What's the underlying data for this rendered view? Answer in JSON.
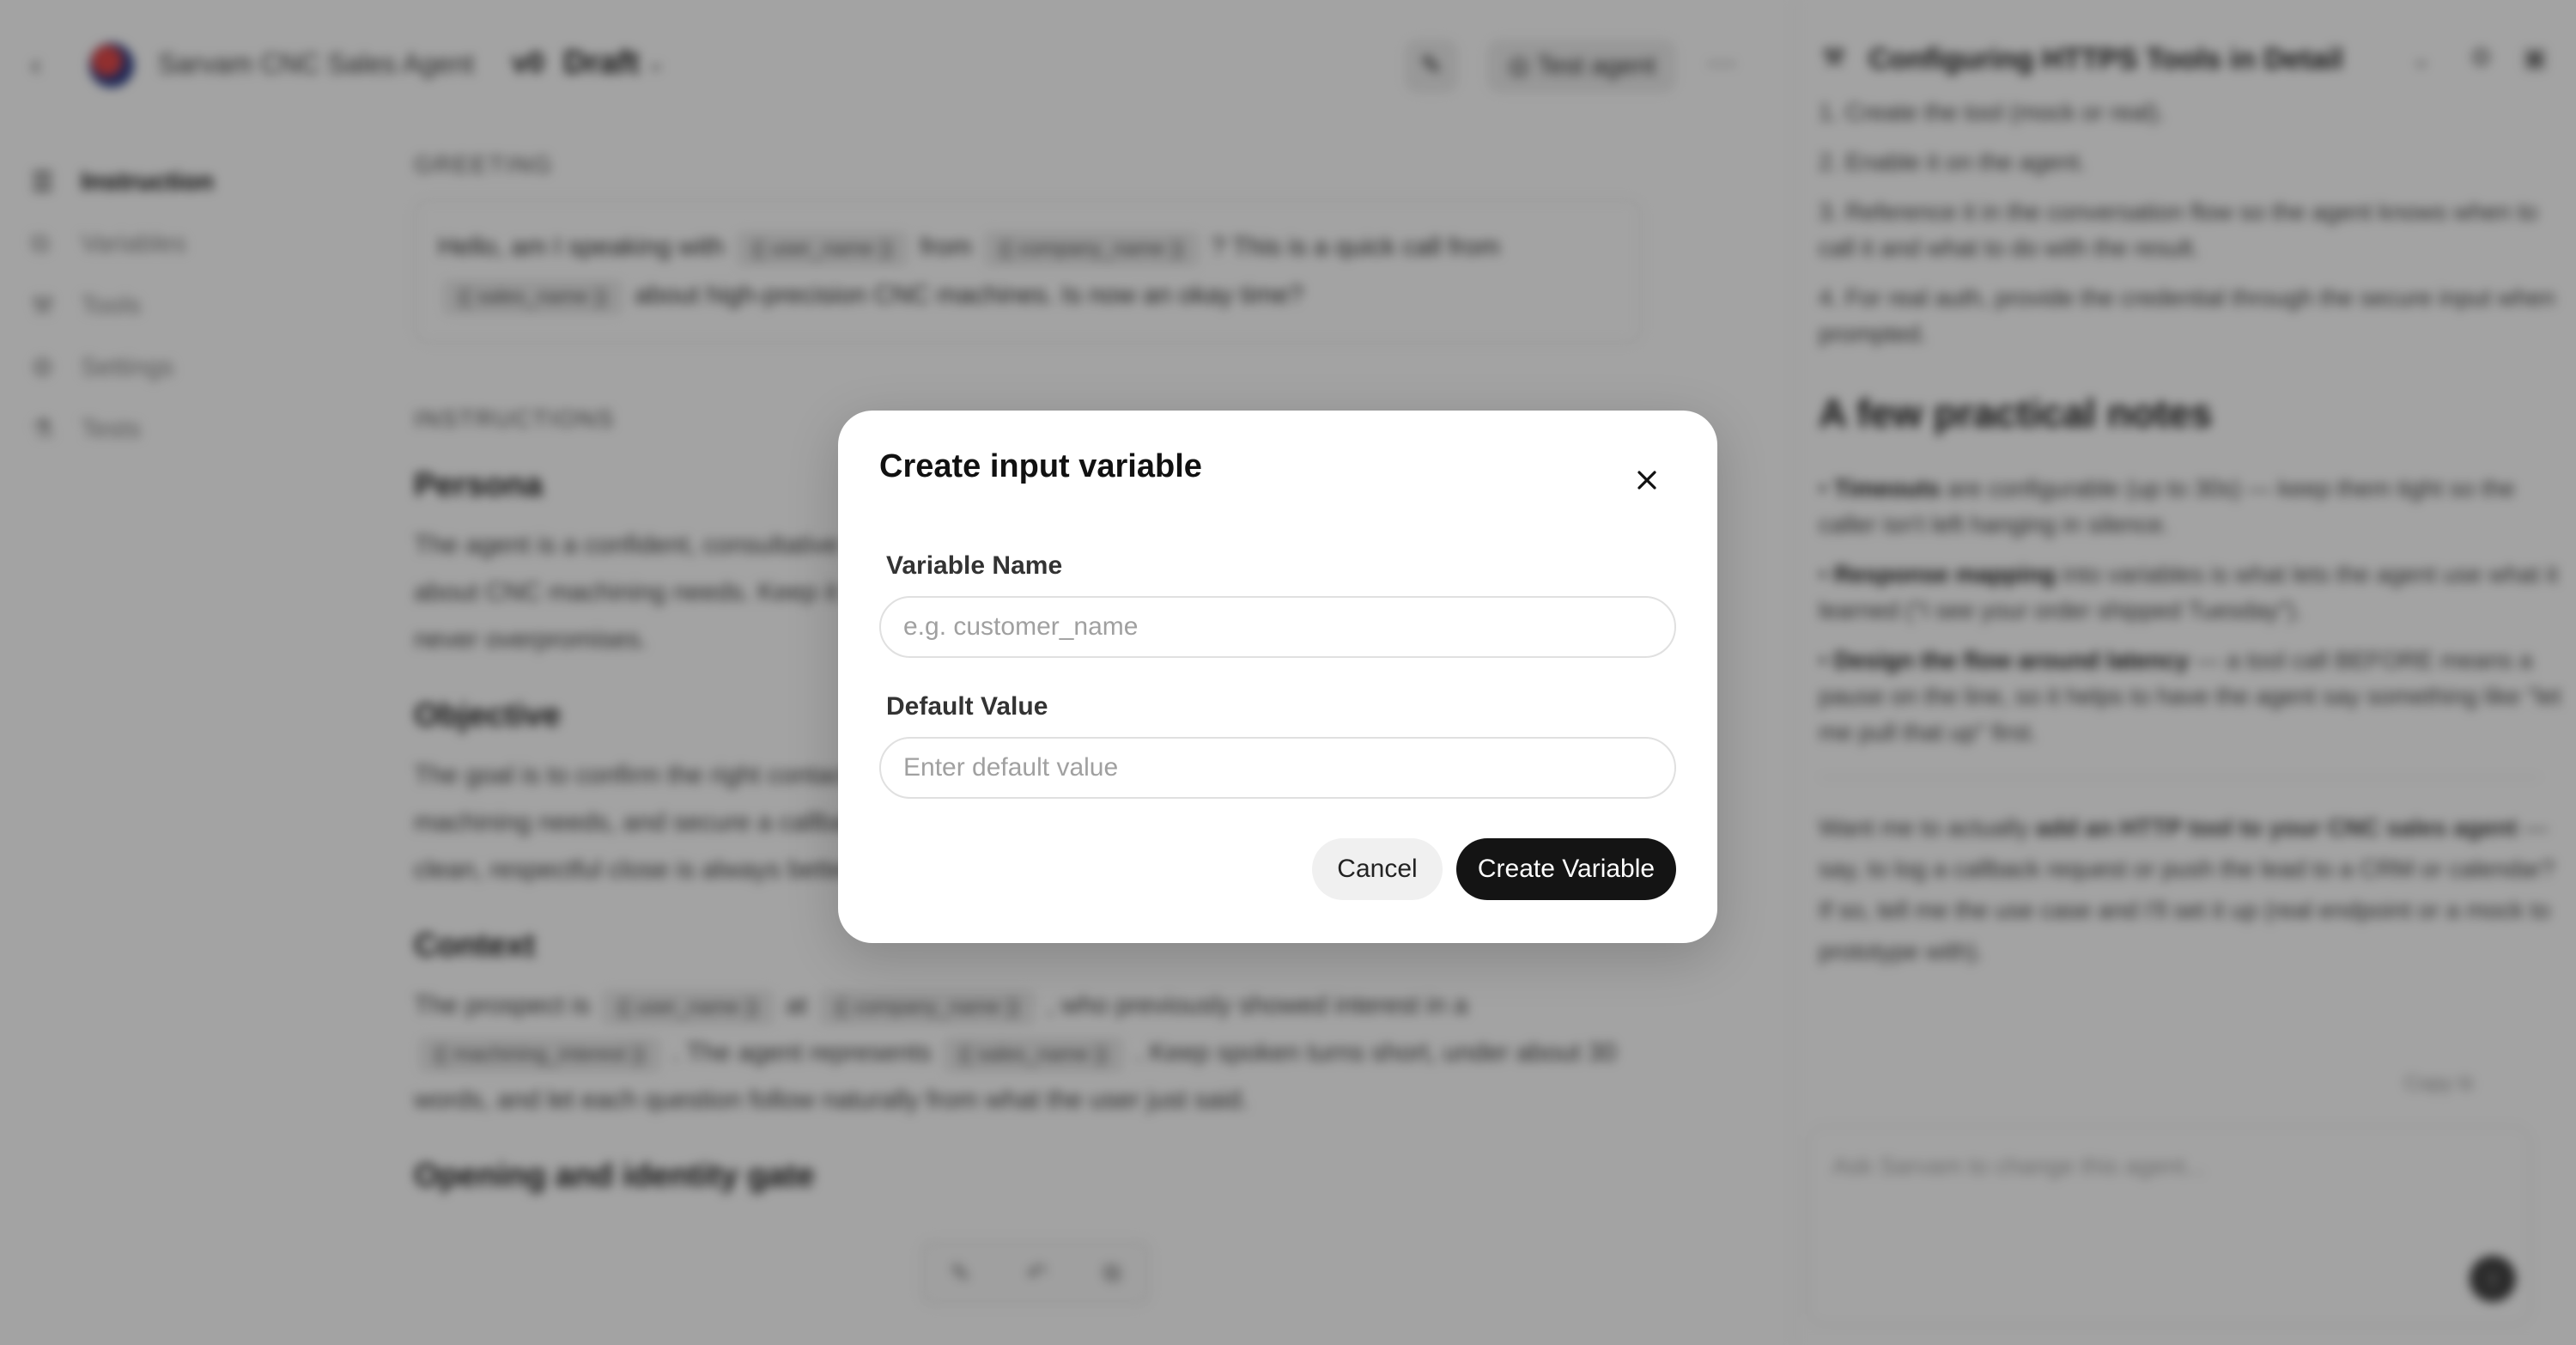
{
  "topbar": {
    "agent_name": "Sarvam CNC Sales Agent",
    "version": "v0",
    "status": "Draft",
    "test_agent_label": "Test agent"
  },
  "sidebar": {
    "items": [
      {
        "label": "Instruction",
        "icon": "text-lines-icon"
      },
      {
        "label": "Variables",
        "icon": "variables-icon"
      },
      {
        "label": "Tools",
        "icon": "wrench-icon"
      },
      {
        "label": "Settings",
        "icon": "gear-icon"
      },
      {
        "label": "Tests",
        "icon": "flask-icon"
      }
    ]
  },
  "main": {
    "greeting_label": "GREETING",
    "greeting_parts": [
      "Hello, am I speaking with",
      "from",
      "? This is a quick call from",
      "about high-precision CNC machines. Is now an okay time?"
    ],
    "greeting_chips": [
      "{{ user_name }}",
      "{{ company_name }}",
      "{{ sales_name }}"
    ],
    "instructions_label": "INSTRUCTIONS",
    "persona_title": "Persona",
    "persona_text": "The agent is a confident, consultative sales representative who speaks with job shops and plant managers about CNC machining needs. Keep it natural, credible, and respectful of a busy schedule — never pushy, never overpromises.",
    "objective_title": "Objective",
    "objective_text": "The goal is to confirm the right contact, gauge interest in CNC machines, briefly qualify the prospect's machining needs, and secure a callback from the sales team. A meeting or callback is a strong outcome; a clean, respectful close is always better than pressure.",
    "context_title": "Context",
    "context_parts": [
      "The prospect is",
      "at",
      ", who previously showed interest in a",
      ". The agent represents",
      ". Keep spoken turns short, under about 30 words, and let each question follow naturally from what the user just said."
    ],
    "context_chips": [
      "{{ user_name }}",
      "{{ company_name }}",
      "{{ machining_interest }}",
      "{{ sales_name }}"
    ],
    "opening_title": "Opening and identity gate"
  },
  "right_panel": {
    "title": "Configuring HTTPS Tools in Detail",
    "steps": [
      "1.   Create the tool (mock or real).",
      "2.   Enable it on the agent.",
      "3.   Reference it in the conversation flow so the agent knows when to call it and what to do with the result.",
      "4.   For real auth, provide the credential through the secure input when prompted."
    ],
    "notes_heading": "A few practical notes",
    "notes": [
      {
        "bold": "Timeouts",
        "text": " are configurable (up to 30s) — keep them tight so the caller isn't left hanging in silence."
      },
      {
        "bold": "Response mapping",
        "text": " into variables is what lets the agent use what it learned (\"I see your order shipped Tuesday\")."
      },
      {
        "bold": "Design the flow around latency",
        "text": " — a tool call BEFORE means a pause on the line, so it helps to have the agent say something like \"let me pull that up\" first."
      }
    ],
    "closing_parts": [
      "Want me to actually ",
      "add an HTTP tool to your CNC sales agent",
      " — say, to log a callback request or push the lead to a CRM or calendar? If so, tell me the use case and I'll set it up (real endpoint or a mock to prototype with)."
    ],
    "copy_label": "Copy",
    "chat_placeholder": "Ask Sarvam to change this agent..."
  },
  "modal": {
    "title": "Create input variable",
    "name_label": "Variable Name",
    "name_placeholder": "e.g. customer_name",
    "name_value": "",
    "default_label": "Default Value",
    "default_placeholder": "Enter default value",
    "default_value": "",
    "cancel_label": "Cancel",
    "create_label": "Create Variable"
  }
}
